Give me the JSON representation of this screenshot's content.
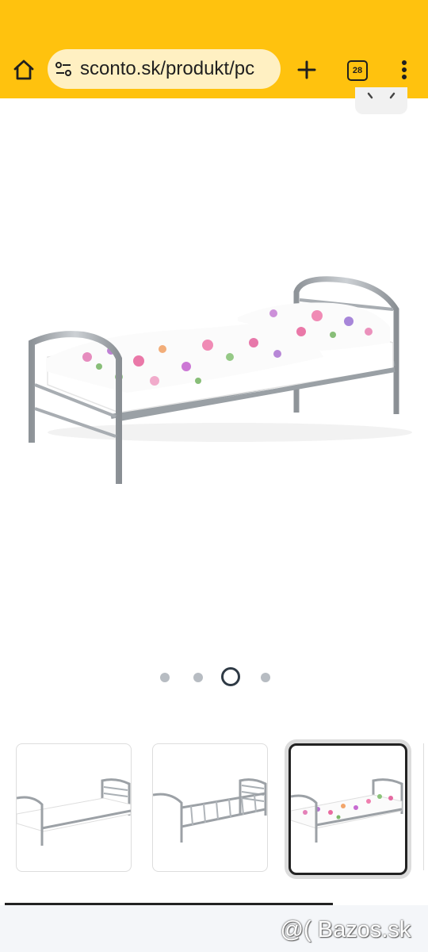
{
  "browser": {
    "url": "sconto.sk/produkt/pc",
    "tab_count": "28",
    "toolbar_color": "#ffc20e",
    "urlbar_color": "#fff0c2"
  },
  "gallery": {
    "total_images": 4,
    "active_index": 2,
    "thumbnails": [
      {
        "name": "bed-with-mattress",
        "selected": false
      },
      {
        "name": "bed-frame-only",
        "selected": false
      },
      {
        "name": "bed-with-floral-bedding",
        "selected": true
      }
    ]
  },
  "watermark": "@( Bazos.sk"
}
